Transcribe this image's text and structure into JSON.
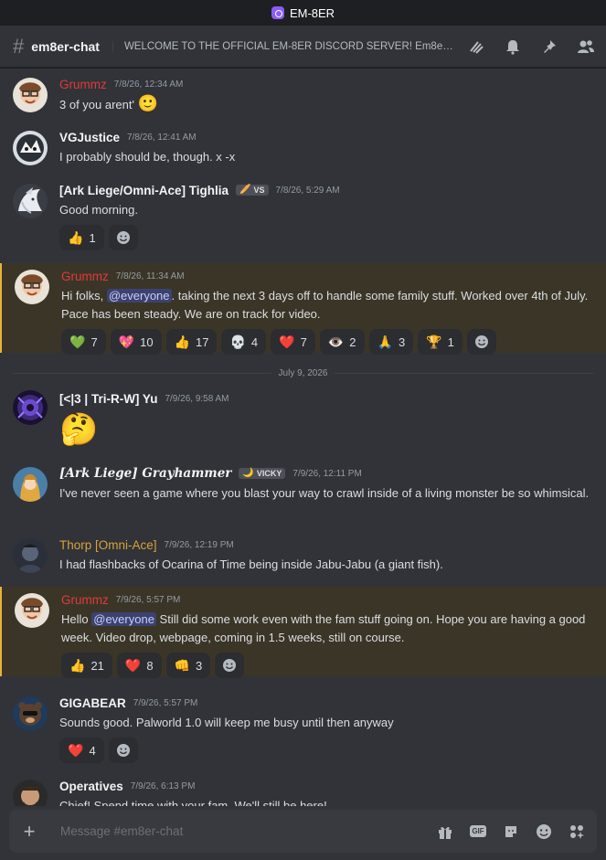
{
  "app": {
    "title": "EM-8ER",
    "icon": "app-logo-icon"
  },
  "header": {
    "channel_icon": "#",
    "channel_name": "em8er-chat",
    "topic": "WELCOME TO THE OFFICIAL EM-8ER DISCORD SERVER! Em8er Cha...",
    "icons": [
      "threads-icon",
      "bell-icon",
      "pin-icon",
      "members-icon"
    ]
  },
  "messages": [
    {
      "author": "Grummz",
      "timestamp": "7/8/26, 12:34 AM",
      "text": "3 of you arent'",
      "emoji": "🙂"
    },
    {
      "author": "VGJustice",
      "timestamp": "7/8/26, 12:41 AM",
      "text": "I probably should be, though. x -x"
    },
    {
      "author": "[Ark Liege/Omni-Ace] Tighlia",
      "tag": "VS",
      "timestamp": "7/8/26, 5:29 AM",
      "text": "Good morning.",
      "reactions": [
        {
          "emoji": "👍",
          "count": "1"
        }
      ]
    },
    {
      "author": "Grummz",
      "timestamp": "7/8/26, 11:34 AM",
      "text_a": "Hi folks, ",
      "mention": "@everyone",
      "text_b": ". taking the next 3 days off to handle some family stuff. Worked over 4th of July. Pace has been steady. We are on track for video.",
      "reactions": [
        {
          "emoji": "💚",
          "count": "7"
        },
        {
          "emoji": "💖",
          "count": "10"
        },
        {
          "emoji": "👍",
          "count": "17"
        },
        {
          "emoji": "💀",
          "count": "4"
        },
        {
          "emoji": "❤️",
          "count": "7"
        },
        {
          "emoji": "👁️",
          "count": "2"
        },
        {
          "emoji": "🙏",
          "count": "3"
        },
        {
          "emoji": "🏆",
          "count": "1"
        }
      ]
    },
    {
      "author": "[<|3 |  Tri-R-W] Yu",
      "timestamp": "7/9/26, 9:58 AM",
      "emoji": "🤔"
    },
    {
      "author": "[Ark Liege] Grayhammer",
      "tag": "VICKY",
      "timestamp": "7/9/26, 12:11 PM",
      "text": "I've never seen a game where you blast your way to crawl inside of a living monster be so whimsical."
    },
    {
      "author": "Thorp [Omni-Ace]",
      "timestamp": "7/9/26, 12:19 PM",
      "text": "I had flashbacks of Ocarina of Time being inside Jabu-Jabu (a giant fish)."
    },
    {
      "author": "Grummz",
      "timestamp": "7/9/26, 5:57 PM",
      "text_a": "Hello ",
      "mention": "@everyone",
      "text_b": " Still did some work even with the fam stuff going on. Hope you are having a good week. Video drop, webpage, coming in 1.5 weeks, still on course.",
      "reactions": [
        {
          "emoji": "👍",
          "count": "21"
        },
        {
          "emoji": "❤️",
          "count": "8"
        },
        {
          "emoji": "👊",
          "count": "3"
        }
      ]
    },
    {
      "author": "GIGABEAR",
      "timestamp": "7/9/26, 5:57 PM",
      "text": "Sounds good. Palworld 1.0 will keep me busy until then anyway",
      "reactions": [
        {
          "emoji": "❤️",
          "count": "4"
        }
      ]
    },
    {
      "author": "Operatives",
      "timestamp": "7/9/26, 6:13 PM",
      "text": "Chief! Spend time with your fam. We'll still be here!"
    }
  ],
  "divider": "July 9, 2026",
  "composer": {
    "placeholder": "Message #em8er-chat",
    "icons": [
      "gift-icon",
      "gif-icon",
      "sticker-icon",
      "emoji-icon",
      "apps-icon"
    ],
    "gif_label": "GIF"
  },
  "colors": {
    "accent": "#5865f2",
    "highlight_bar": "#e8b33b",
    "grummz": "#e03a3a",
    "thorp": "#d9a13b"
  }
}
